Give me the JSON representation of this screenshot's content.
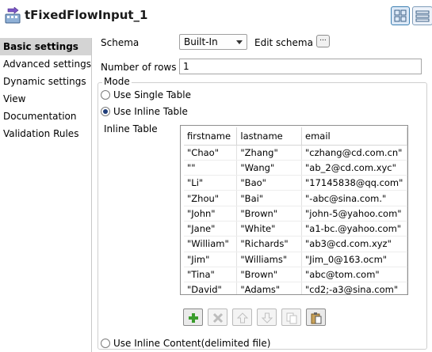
{
  "component": {
    "title": "tFixedFlowInput_1",
    "icon": "component-flow-icon"
  },
  "view_toggle": [
    {
      "icon": "grid-view-icon",
      "active": true
    },
    {
      "icon": "list-view-icon",
      "active": false
    }
  ],
  "sidebar": {
    "items": [
      {
        "label": "Basic settings",
        "active": true
      },
      {
        "label": "Advanced settings",
        "active": false
      },
      {
        "label": "Dynamic settings",
        "active": false
      },
      {
        "label": "View",
        "active": false
      },
      {
        "label": "Documentation",
        "active": false
      },
      {
        "label": "Validation Rules",
        "active": false
      }
    ]
  },
  "schema": {
    "label": "Schema",
    "value": "Built-In",
    "edit_label": "Edit schema",
    "edit_button": "..."
  },
  "rows": {
    "label": "Number of rows",
    "value": "1"
  },
  "mode": {
    "legend": "Mode",
    "options": [
      {
        "label": "Use Single Table",
        "checked": false
      },
      {
        "label": "Use Inline Table",
        "checked": true
      },
      {
        "label": "Use Inline Content(delimited file)",
        "checked": false
      }
    ]
  },
  "inline_table": {
    "label": "Inline Table",
    "columns": [
      "firstname",
      "lastname",
      "email"
    ],
    "rows": [
      [
        "\"Chao\"",
        "\"Zhang\"",
        "\"czhang@cd.com.cn\""
      ],
      [
        "\"\"",
        "\"Wang\"",
        "\"ab_2@cd.com.xyc\""
      ],
      [
        "\"Li\"",
        "\"Bao\"",
        "\"17145838@qq.com\""
      ],
      [
        "\"Zhou\"",
        "\"Bai\"",
        "\"-abc@sina.com.\""
      ],
      [
        "\"John\"",
        "\"Brown\"",
        "\"john-5@yahoo.com\""
      ],
      [
        "\"Jane\"",
        "\"White\"",
        "\"a1-bc.@yahoo.com\""
      ],
      [
        "\"William\"",
        "\"Richards\"",
        "\"ab3@cd.com.xyz\""
      ],
      [
        "\"Jim\"",
        "\"Williams\"",
        "\"Jim_0@163.ocm\""
      ],
      [
        "\"Tina\"",
        "\"Brown\"",
        "\"abc@tom.com\""
      ],
      [
        "\"David\"",
        "\"Adams\"",
        "\"cd2;-a3@sina.com\""
      ]
    ]
  },
  "table_toolbar": [
    {
      "icon": "add-row-icon",
      "enabled": true
    },
    {
      "icon": "delete-row-icon",
      "enabled": false
    },
    {
      "icon": "move-up-icon",
      "enabled": false
    },
    {
      "icon": "move-down-icon",
      "enabled": false
    },
    {
      "icon": "copy-icon",
      "enabled": false
    },
    {
      "icon": "paste-icon",
      "enabled": true
    }
  ],
  "colors": {
    "active_sidebar": "#d4d4d4",
    "add_icon": "#3a9c2c",
    "radio_dot": "#1f3d7a"
  }
}
